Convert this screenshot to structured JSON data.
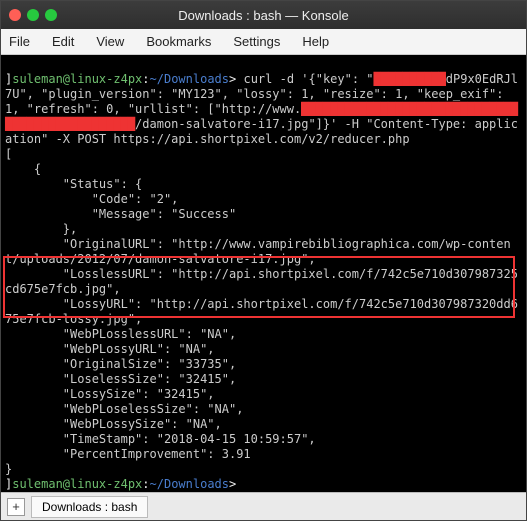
{
  "titlebar": {
    "title": "Downloads : bash — Konsole"
  },
  "menu": {
    "file": "File",
    "edit": "Edit",
    "view": "View",
    "bookmarks": "Bookmarks",
    "settings": "Settings",
    "help": "Help"
  },
  "term": {
    "prompt_user": "suleman@linux-z4px",
    "prompt_path": "~/Downloads",
    "prompt_suffix": ">",
    "cmd": "curl -d '{\"key\": \"",
    "red1": "██████████",
    "cmd2": "dP9x0EdRJl7U\", \"plugin_version\": \"MY123\", \"lossy\": 1, \"resize\": 1, \"keep_exif\": 1, \"refresh\": 0, \"urllist\": [\"http://www.",
    "red2": "████████████████████████████████████████████████",
    "cmd3": "/damon-salvatore-i17.jpg\"]}' -H \"Content-Type: application\" -X POST https://api.shortpixel.com/v2/reducer.php",
    "l1": "[",
    "l2": "    {",
    "l3": "        \"Status\": {",
    "l4": "            \"Code\": \"2\",",
    "l5": "            \"Message\": \"Success\"",
    "l6": "        },",
    "l7": "        \"OriginalURL\": \"http://www.vampirebibliographica.com/wp-content/uploads/2012/07/damon-salvatore-i17.jpg\",",
    "l8": "        \"LosslessURL\": \"http://api.shortpixel.com/f/742c5e710d307987325cd675e7fcb.jpg\",",
    "l9": "        \"LossyURL\": \"http://api.shortpixel.com/f/742c5e710d307987320dd675e7fcb-lossy.jpg\",",
    "l10": "        \"WebPLosslessURL\": \"NA\",",
    "l11": "        \"WebPLossyURL\": \"NA\",",
    "l12": "        \"OriginalSize\": \"33735\",",
    "l13": "        \"LoselessSize\": \"32415\",",
    "l14": "        \"LossySize\": \"32415\",",
    "l15": "        \"WebPLoselessSize\": \"NA\",",
    "l16": "        \"WebPLossySize\": \"NA\",",
    "l17": "        \"TimeStamp\": \"2018-04-15 10:59:57\",",
    "l18": "        \"PercentImprovement\": 3.91",
    "l19": "}",
    "prompt2_suffix": ">"
  },
  "tabs": {
    "new": "+",
    "tab1": "Downloads : bash"
  }
}
